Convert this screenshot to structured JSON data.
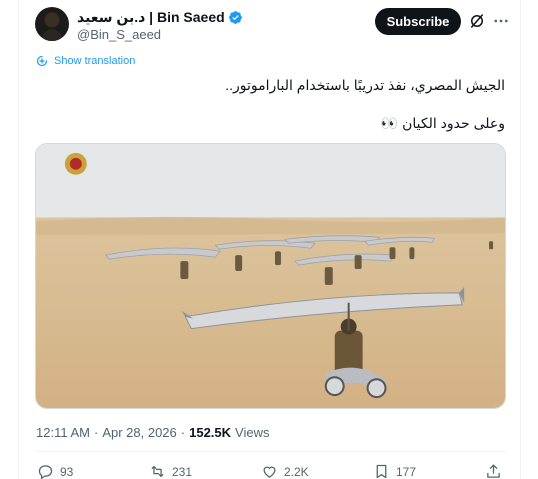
{
  "author": {
    "display_name": "د.بن سعيد | Bin Saeed",
    "handle": "@Bin_S_aeed",
    "verified": true
  },
  "header": {
    "subscribe_label": "Subscribe",
    "icons": [
      "grok-icon",
      "more-icon"
    ]
  },
  "translate_label": "Show translation",
  "tweet": {
    "lines": [
      "الجيش المصري، نفذ تدريبًا باستخدام الباراموتور..",
      "وعلى حدود الكيان 👀"
    ]
  },
  "media": {
    "type": "video-thumbnail",
    "description_colors": {
      "sky": "#e6e8ea",
      "sand": "#d8b98a"
    }
  },
  "meta": {
    "time": "12:11 AM",
    "separator": "·",
    "date": "Apr 28, 2026",
    "views_count": "152.5K",
    "views_label": "Views"
  },
  "actions": {
    "replies": "93",
    "reposts": "231",
    "likes": "2.2K",
    "bookmarks": "177"
  },
  "colors": {
    "accent": "#1d9bf0",
    "text": "#0f1419",
    "muted": "#536471"
  }
}
